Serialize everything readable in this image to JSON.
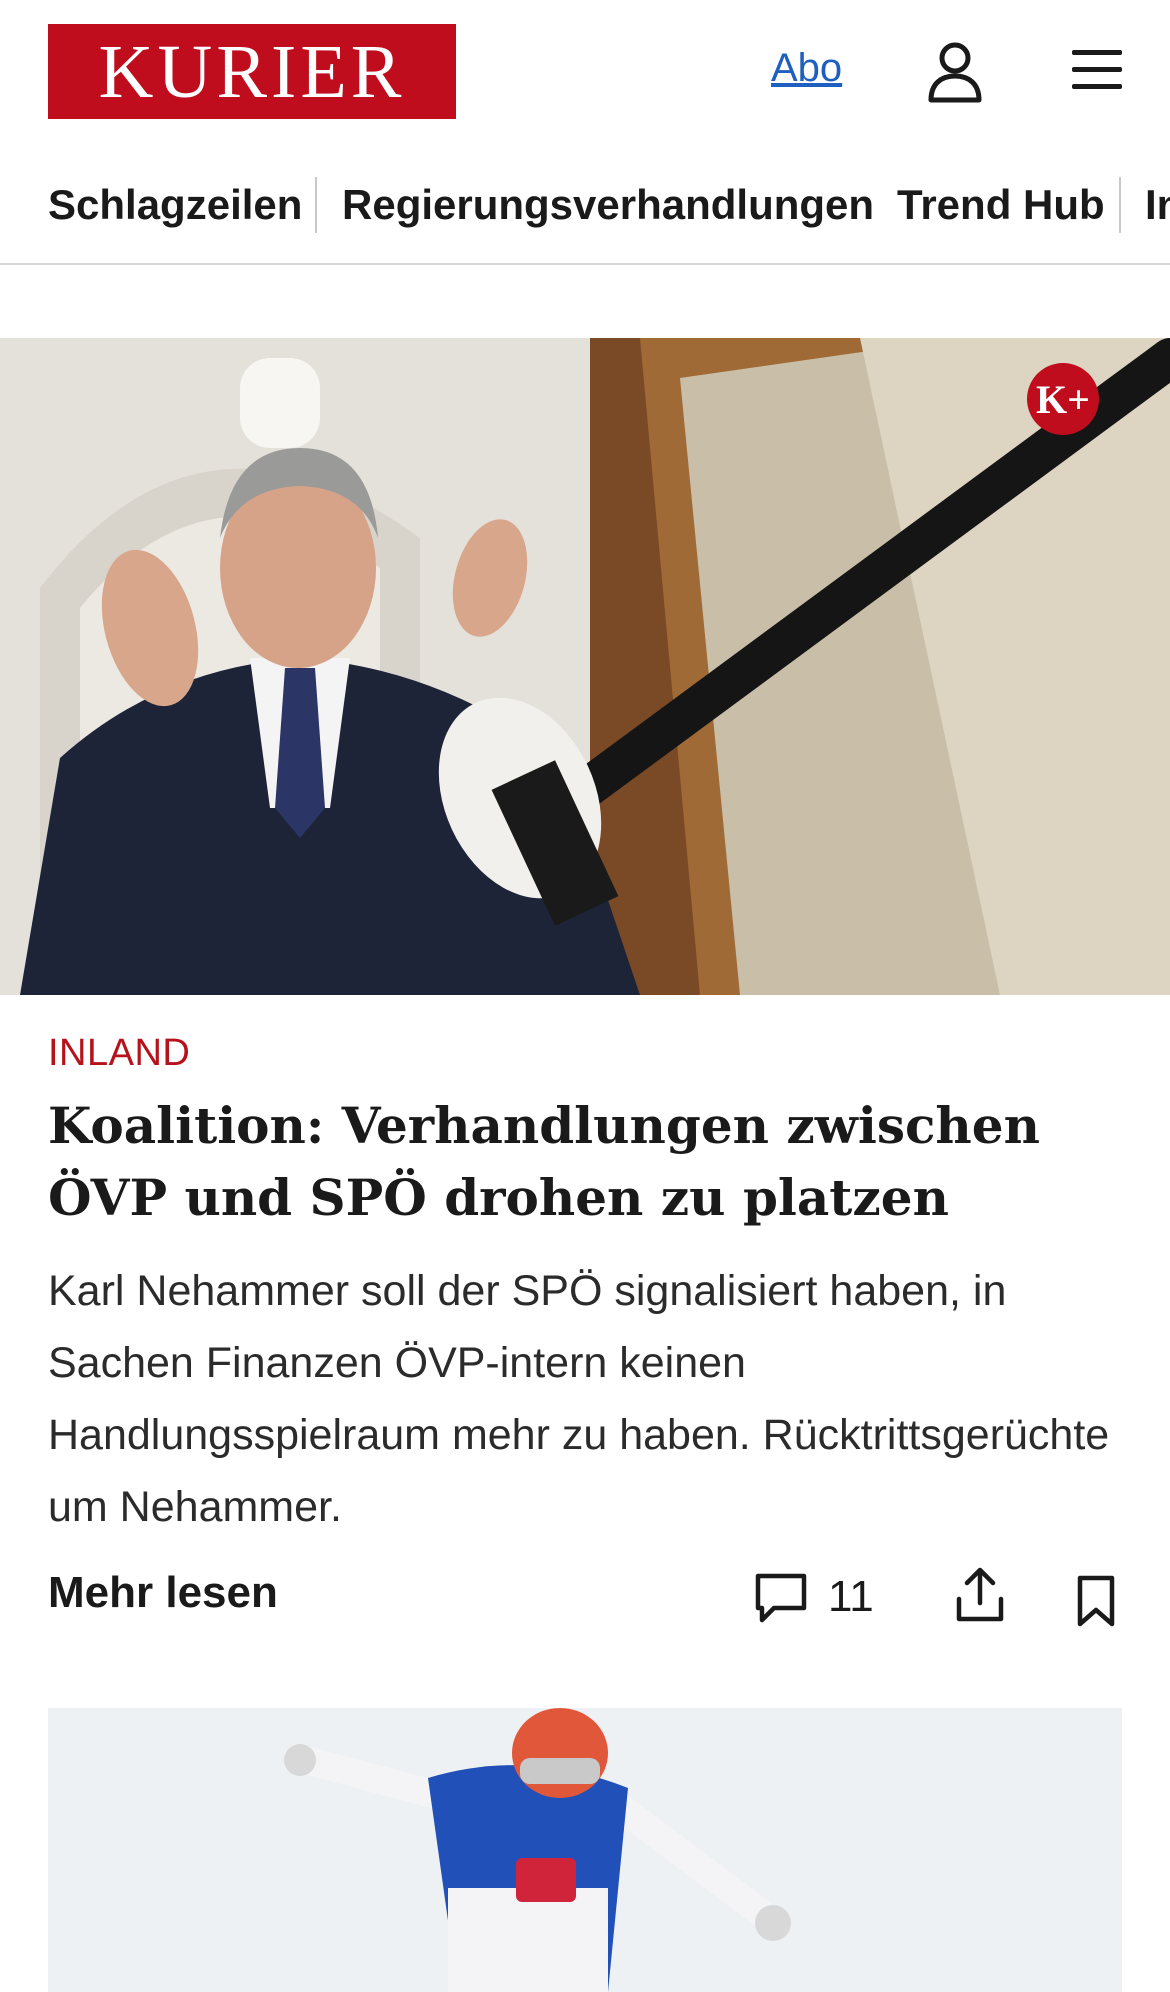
{
  "header": {
    "logo_text": "KURIER",
    "abo_label": "Abo",
    "user_icon": "user-icon",
    "menu_icon": "hamburger-menu-icon"
  },
  "nav": {
    "items": [
      {
        "label": "Schlagzeilen"
      },
      {
        "label": "Regierungsverhandlungen"
      },
      {
        "label": "Trend Hub"
      },
      {
        "label": "In"
      }
    ]
  },
  "hero": {
    "image_name": "hero-image",
    "badge_text": "K+"
  },
  "article": {
    "category": "INLAND",
    "headline": "Koalition: Verhandlungen zwischen ÖVP und SPÖ drohen zu platzen",
    "teaser": "Karl Nehammer soll der SPÖ signalisiert haben, in Sachen Finanzen ÖVP-intern keinen Handlungsspielraum mehr zu haben. Rücktrittsgerüchte um Nehammer.",
    "more_label": "Mehr lesen",
    "comment_count": "11",
    "comment_icon": "comment-icon",
    "share_icon": "share-icon",
    "bookmark_icon": "bookmark-icon"
  },
  "next_article": {
    "image_name": "next-article-image"
  },
  "colors": {
    "brand_red": "#c00d1e",
    "category_red": "#b5121b",
    "link_blue": "#1f5fbf"
  }
}
